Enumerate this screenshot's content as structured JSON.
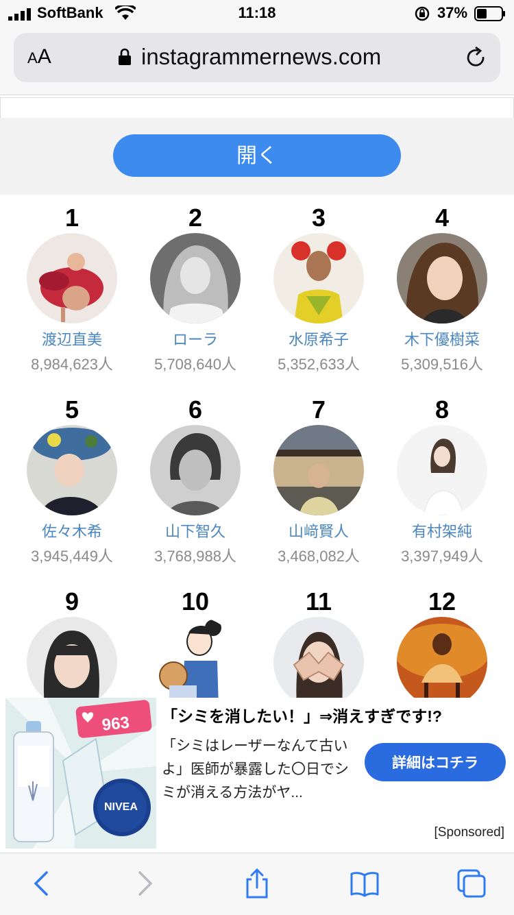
{
  "status": {
    "carrier": "SoftBank",
    "time": "11:18",
    "battery": "37%"
  },
  "browser": {
    "aa_small": "A",
    "aa_large": "A",
    "url": "instagrammernews.com"
  },
  "banner": {
    "open_label": "開く"
  },
  "ranking": [
    {
      "rank": "1",
      "name": "渡辺直美",
      "followers": "8,984,623人"
    },
    {
      "rank": "2",
      "name": "ローラ",
      "followers": "5,708,640人"
    },
    {
      "rank": "3",
      "name": "水原希子",
      "followers": "5,352,633人"
    },
    {
      "rank": "4",
      "name": "木下優樹菜",
      "followers": "5,309,516人"
    },
    {
      "rank": "5",
      "name": "佐々木希",
      "followers": "3,945,449人"
    },
    {
      "rank": "6",
      "name": "山下智久",
      "followers": "3,768,988人"
    },
    {
      "rank": "7",
      "name": "山﨑賢人",
      "followers": "3,468,082人"
    },
    {
      "rank": "8",
      "name": "有村架純",
      "followers": "3,397,949人"
    },
    {
      "rank": "9",
      "name": "",
      "followers": ""
    },
    {
      "rank": "10",
      "name": "",
      "followers": ""
    },
    {
      "rank": "11",
      "name": "",
      "followers": ""
    },
    {
      "rank": "12",
      "name": "",
      "followers": ""
    }
  ],
  "ad": {
    "likes": "963",
    "nivea_label": "NIVEA",
    "title": "「シミを消したい！」⇒消えすぎです!?",
    "body": "「シミはレーザーなんて古いよ」医師が暴露した〇日でシミが消える方法がヤ...",
    "cta": "詳細はコチラ",
    "sponsored": "[Sponsored]"
  },
  "colors": {
    "accent": "#3d8bee",
    "name_link": "#4a86c0",
    "cta": "#2b6be0",
    "toolbar_icon": "#2f7bf0"
  }
}
